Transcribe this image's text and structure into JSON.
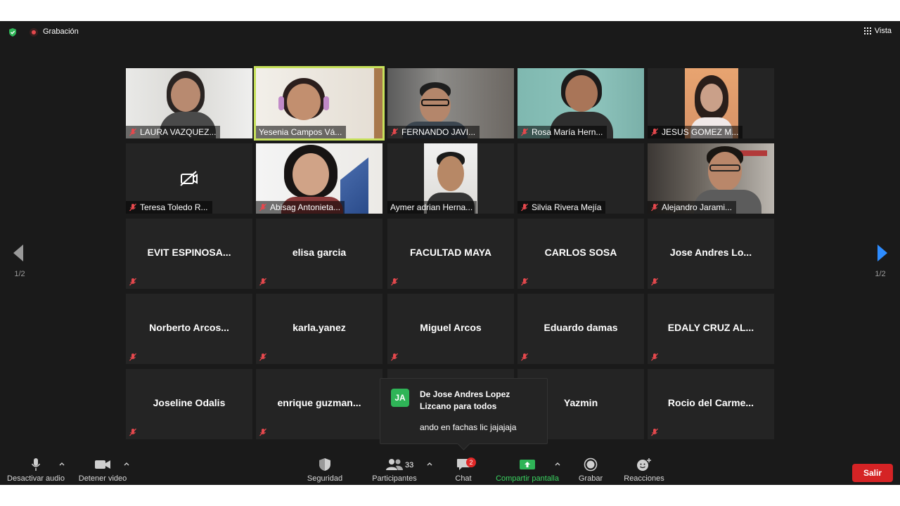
{
  "topbar": {
    "recording_label": "Grabación",
    "view_label": "Vista"
  },
  "pagination": {
    "left_indicator": "1/2",
    "right_indicator": "1/2"
  },
  "video_tiles": [
    {
      "name": "LAURA VAZQUEZ...",
      "muted": true
    },
    {
      "name": "Yesenia Campos Vá...",
      "muted": false,
      "active_speaker": true
    },
    {
      "name": "FERNANDO JAVI...",
      "muted": true
    },
    {
      "name": "Rosa María Hern...",
      "muted": true
    },
    {
      "name": "JESUS GOMEZ M...",
      "muted": true
    },
    {
      "name": "Teresa Toledo R...",
      "muted": true,
      "camera_off": true
    },
    {
      "name": "Abisag Antonieta...",
      "muted": true
    },
    {
      "name": "Aymer adrian Herna...",
      "muted": false
    },
    {
      "name": "Silvia Rivera Mejía",
      "muted": true
    },
    {
      "name": "Alejandro Jarami...",
      "muted": true
    }
  ],
  "name_tiles": [
    "EVIT  ESPINOSA...",
    "elisa garcia",
    "FACULTAD MAYA",
    "CARLOS SOSA",
    "Jose  Andres Lo...",
    "Norberto  Arcos...",
    "karla.yanez",
    "Miguel Arcos",
    "Eduardo damas",
    "EDALY CRUZ AL...",
    "Joseline Odalis",
    "enrique  guzman...",
    "",
    "Yazmin",
    "Rocio  del  Carme..."
  ],
  "chat_popup": {
    "initials": "JA",
    "from": "De Jose  Andres Lopez Lizcano para todos",
    "message": "ando en fachas lic jajajaja"
  },
  "toolbar": {
    "audio_label": "Desactivar audio",
    "video_label": "Detener video",
    "security_label": "Seguridad",
    "participants_label": "Participantes",
    "participants_count": "33",
    "chat_label": "Chat",
    "chat_badge": "2",
    "share_label": "Compartir pantalla",
    "record_label": "Grabar",
    "reactions_label": "Reacciones",
    "leave_label": "Salir"
  },
  "colors": {
    "background": "#1a1a1a",
    "tile": "#242424",
    "speaker_outline": "#c6e05a",
    "share_green": "#3ad461",
    "leave_red": "#d52325",
    "muted_red": "#e5484d"
  }
}
